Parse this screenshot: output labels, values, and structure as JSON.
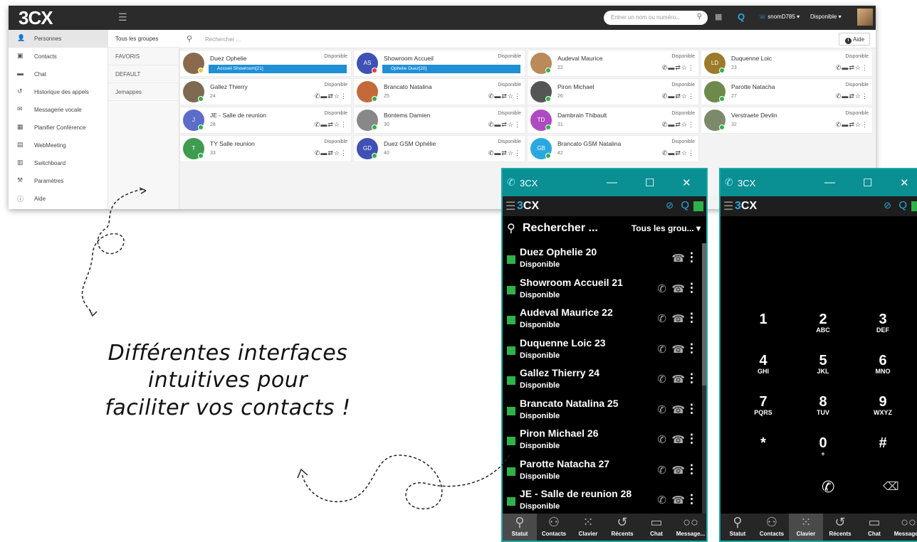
{
  "web": {
    "logo": "3CX",
    "search_placeholder": "Entrer un nom ou numéro...",
    "extension": "snomD785",
    "status": "Disponible",
    "sidebar": [
      {
        "label": "Personnes",
        "icon": "person-icon"
      },
      {
        "label": "Contacts",
        "icon": "contacts-icon"
      },
      {
        "label": "Chat",
        "icon": "chat-icon"
      },
      {
        "label": "Historique des appels",
        "icon": "history-icon"
      },
      {
        "label": "Messagerie vocale",
        "icon": "voicemail-icon"
      },
      {
        "label": "Planifier Conférence",
        "icon": "calendar-icon"
      },
      {
        "label": "WebMeeting",
        "icon": "webmeeting-icon"
      },
      {
        "label": "Switchboard",
        "icon": "switchboard-icon"
      },
      {
        "label": "Paramètres",
        "icon": "wrench-icon"
      },
      {
        "label": "Aide",
        "icon": "info-icon"
      }
    ],
    "groups": [
      "Tous les groupes",
      "FAVORIS",
      "DEFAULT",
      "Jemappes"
    ],
    "main_search_placeholder": "Rechercher ...",
    "help_label": "Aide",
    "cards": [
      {
        "name": "Duez Ophelie",
        "status": "Disponible",
        "ext": "",
        "call_bar": "Accueil Showroom[21]"
      },
      {
        "name": "Showroom Accueil",
        "status": "Disponible",
        "ext": "",
        "call_bar": "Ophelie Duez[20]",
        "initials": "AS"
      },
      {
        "name": "Audeval Maurice",
        "status": "Disponible",
        "ext": "22"
      },
      {
        "name": "Duquenne Loic",
        "status": "Disponible",
        "ext": "23",
        "initials": "LD"
      },
      {
        "name": "Gallez Thierry",
        "status": "Disponible",
        "ext": "24"
      },
      {
        "name": "Brancato Natalina",
        "status": "Disponible",
        "ext": "25"
      },
      {
        "name": "Piron Michael",
        "status": "Disponible",
        "ext": "26"
      },
      {
        "name": "Parotte Natacha",
        "status": "Disponible",
        "ext": "27"
      },
      {
        "name": "JE - Salle de reunion",
        "status": "Disponible",
        "ext": "28",
        "initials": "J"
      },
      {
        "name": "Bontems Damien",
        "status": "Disponible",
        "ext": "30"
      },
      {
        "name": "Dambrain Thibault",
        "status": "Disponible",
        "ext": "31",
        "initials": "TD"
      },
      {
        "name": "Verstraete Devlin",
        "status": "Disponible",
        "ext": "32"
      },
      {
        "name": "TY Salle reunion",
        "status": "Disponible",
        "ext": "33",
        "initials": "T"
      },
      {
        "name": "Duez GSM Ophélie",
        "status": "Disponible",
        "ext": "40",
        "initials": "GD"
      },
      {
        "name": "Brancato GSM Natalina",
        "status": "Disponible",
        "ext": "42",
        "initials": "GB"
      }
    ]
  },
  "phone": {
    "title": "3CX",
    "logo": "3CX",
    "search": "Rechercher ...",
    "group_filter": "Tous les grou...",
    "contacts": [
      {
        "name": "Duez Ophelie 20",
        "status": "Disponible"
      },
      {
        "name": "Showroom Accueil 21",
        "status": "Disponible"
      },
      {
        "name": "Audeval Maurice 22",
        "status": "Disponible"
      },
      {
        "name": "Duquenne Loic 23",
        "status": "Disponible"
      },
      {
        "name": "Gallez Thierry 24",
        "status": "Disponible"
      },
      {
        "name": "Brancato Natalina 25",
        "status": "Disponible"
      },
      {
        "name": "Piron Michael 26",
        "status": "Disponible"
      },
      {
        "name": "Parotte Natacha 27",
        "status": "Disponible"
      },
      {
        "name": "JE - Salle de reunion 28",
        "status": "Disponible"
      }
    ],
    "nav": [
      "Statut",
      "Contacts",
      "Clavier",
      "Récents",
      "Chat",
      "Message..."
    ],
    "keypad": [
      {
        "d": "1",
        "l": ""
      },
      {
        "d": "2",
        "l": "ABC"
      },
      {
        "d": "3",
        "l": "DEF"
      },
      {
        "d": "4",
        "l": "GHI"
      },
      {
        "d": "5",
        "l": "JKL"
      },
      {
        "d": "6",
        "l": "MNO"
      },
      {
        "d": "7",
        "l": "PQRS"
      },
      {
        "d": "8",
        "l": "TUV"
      },
      {
        "d": "9",
        "l": "WXYZ"
      },
      {
        "d": "*",
        "l": ""
      },
      {
        "d": "0",
        "l": "+"
      },
      {
        "d": "#",
        "l": ""
      }
    ]
  },
  "tagline": {
    "line1": "Différentes interfaces",
    "line2": "intuitives pour",
    "line3": "faciliter vos contacts !"
  }
}
